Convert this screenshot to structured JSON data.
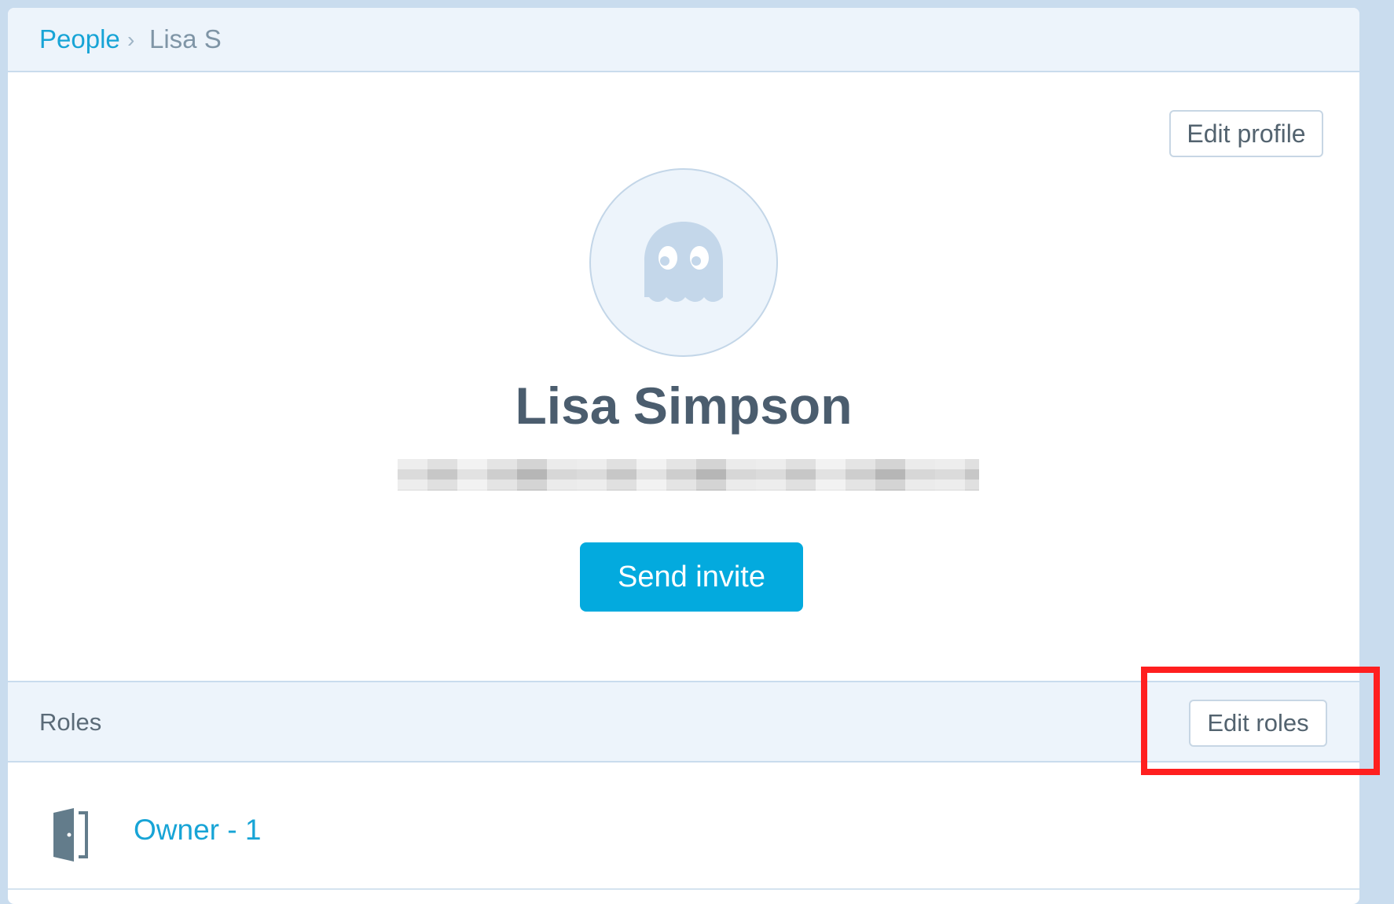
{
  "breadcrumb": {
    "parent": "People",
    "separator": "›",
    "current": "Lisa S"
  },
  "profile": {
    "edit_button": "Edit profile",
    "avatar_icon": "ghost-icon",
    "name": "Lisa Simpson",
    "email": "",
    "send_invite": "Send invite"
  },
  "roles": {
    "title": "Roles",
    "edit_button": "Edit roles",
    "items": [
      {
        "icon": "door-icon",
        "label": "Owner - 1"
      }
    ]
  },
  "colors": {
    "accent": "#03aade",
    "link": "#17a4d6",
    "highlight": "#ff1f1f",
    "header_bg": "#edf4fb",
    "page_bg": "#c9dcee"
  }
}
